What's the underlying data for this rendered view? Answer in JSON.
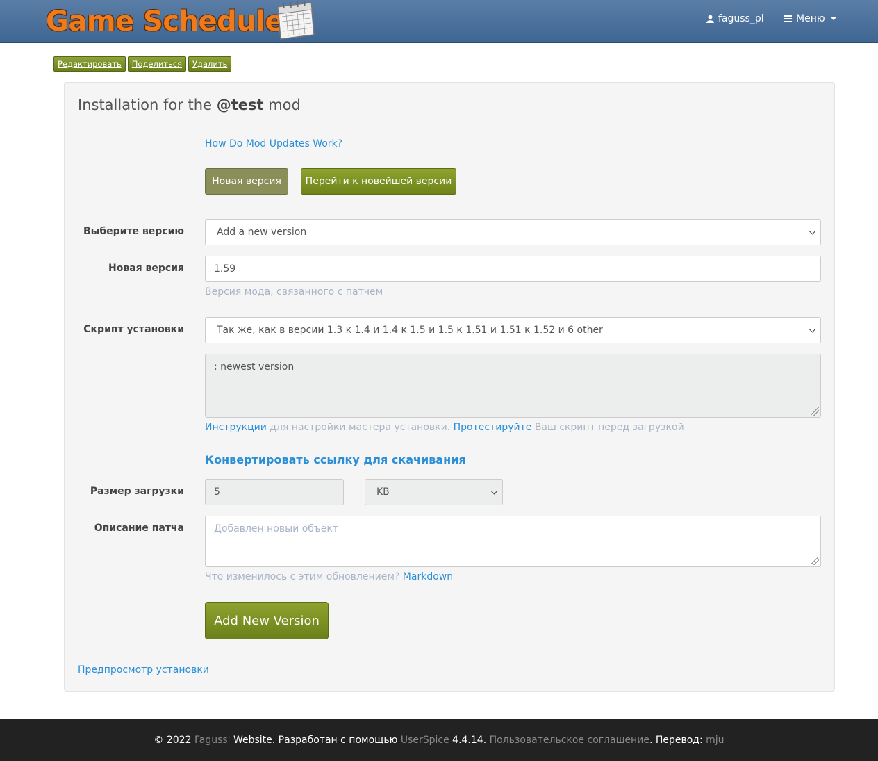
{
  "navbar": {
    "brand": "Game Schedule",
    "user": "faguss_pl",
    "menu": "Меню"
  },
  "toolbar": {
    "edit": "Редактировать",
    "share": "Поделиться",
    "delete": "Удалить"
  },
  "panel": {
    "title_prefix": "Installation for the",
    "title_mod": "@test",
    "title_suffix": "mod",
    "how_link": "How Do Mod Updates Work?",
    "btn_new_version": "Новая версия",
    "btn_go_latest": "Перейти к новейшей версии",
    "select_version_label": "Выберите версию",
    "select_version_value": "Add a new version",
    "new_version_label": "Новая версия",
    "new_version_value": "1.59",
    "new_version_hint": "Версия мода, связанного с патчем",
    "script_label": "Скрипт установки",
    "script_value": "Так же, как в версии 1.3 к 1.4 и 1.4 к 1.5 и 1.5 к 1.51 и 1.51 к 1.52 и 6 other",
    "script_text": "; newest version",
    "instructions_link": "Инструкции",
    "instructions_text": "для настройки мастера установки.",
    "test_link": "Протестируйте",
    "test_text": "Ваш скрипт перед загрузкой",
    "convert_link": "Конвертировать ссылку для скачивания",
    "size_label": "Размер загрузки",
    "size_value": "5",
    "size_unit": "KB",
    "desc_label": "Описание патча",
    "desc_placeholder": "Добавлен новый объект",
    "desc_hint": "Что изменилось с этим обновлением?",
    "markdown_link": "Markdown",
    "submit": "Add New Version",
    "preview_link": "Предпросмотр установки"
  },
  "footer": {
    "copyright": "© 2022",
    "author": "Faguss'",
    "website": "Website. Разработан с помощью",
    "framework": "UserSpice",
    "version": "4.4.14.",
    "terms": "Пользовательское соглашение",
    "translation": ". Перевод:",
    "translator": "mju"
  },
  "colors": {
    "navbar": "#4a6f9b",
    "brand_orange": "#f07a1a",
    "button_green": "#7d921f",
    "link": "#2a8fd6",
    "footer": "#222222"
  }
}
